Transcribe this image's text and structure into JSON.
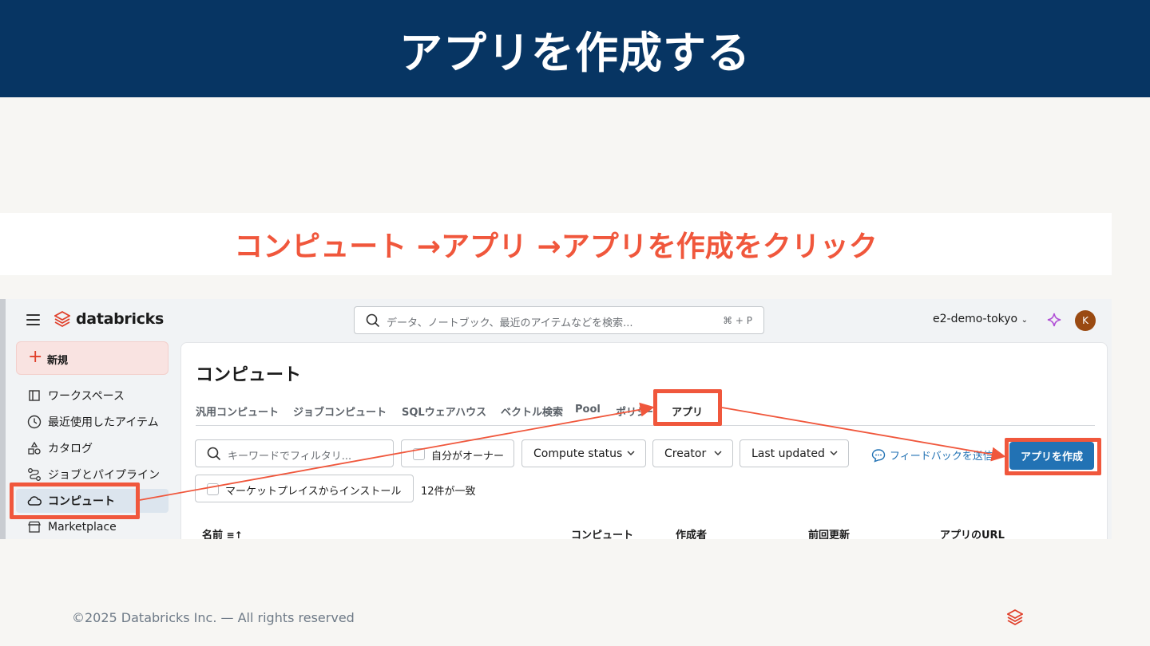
{
  "slide": {
    "title": "アプリを作成する",
    "instruction": "コンピュート →アプリ →アプリを作成をクリック",
    "footer": "©2025 Databricks Inc. — All rights reserved",
    "accent_color": "#f0573c",
    "header_color": "#073563"
  },
  "app": {
    "brand": "databricks",
    "search": {
      "placeholder": "データ、ノートブック、最近のアイテムなどを検索...",
      "shortcut": "⌘ + P"
    },
    "workspace": "e2-demo-tokyo",
    "avatar_initial": "K"
  },
  "sidebar": {
    "new_label": "新規",
    "items": [
      {
        "label": "ワークスペース",
        "icon": "workspace-icon"
      },
      {
        "label": "最近使用したアイテム",
        "icon": "clock-icon"
      },
      {
        "label": "カタログ",
        "icon": "catalog-icon"
      },
      {
        "label": "ジョブとパイプライン",
        "icon": "workflow-icon"
      },
      {
        "label": "コンピュート",
        "icon": "cloud-icon"
      },
      {
        "label": "Marketplace",
        "icon": "store-icon"
      }
    ]
  },
  "main": {
    "title": "コンピュート",
    "tabs": [
      {
        "label": "汎用コンピュート"
      },
      {
        "label": "ジョブコンピュート"
      },
      {
        "label": "SQLウェアハウス"
      },
      {
        "label": "ベクトル検索"
      },
      {
        "label": "Pool"
      },
      {
        "label": "ポリシー"
      },
      {
        "label": "アプリ"
      }
    ],
    "filter_placeholder": "キーワードでフィルタリ...",
    "owner_filter": "自分がオーナー",
    "compute_status": "Compute status",
    "creator": "Creator",
    "last_updated": "Last updated",
    "feedback": "フィードバックを送信",
    "create_button": "アプリを作成",
    "marketplace_filter": "マーケットプレイスからインストール",
    "count": "12件が一致",
    "columns": {
      "name": "名前",
      "compute": "コンピュート",
      "creator": "作成者",
      "updated": "前回更新",
      "url": "アプリのURL"
    }
  }
}
